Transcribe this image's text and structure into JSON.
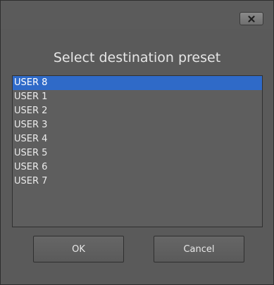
{
  "dialog": {
    "title": "Select destination preset",
    "close_icon": "close-icon"
  },
  "presets": {
    "selected_index": 0,
    "items": [
      {
        "label": "USER 8"
      },
      {
        "label": "USER 1"
      },
      {
        "label": "USER 2"
      },
      {
        "label": "USER 3"
      },
      {
        "label": "USER 4"
      },
      {
        "label": "USER 5"
      },
      {
        "label": "USER 6"
      },
      {
        "label": "USER 7"
      }
    ]
  },
  "buttons": {
    "ok_label": "OK",
    "cancel_label": "Cancel"
  },
  "colors": {
    "selection": "#2f6ac8",
    "background": "#5a5a5a"
  }
}
